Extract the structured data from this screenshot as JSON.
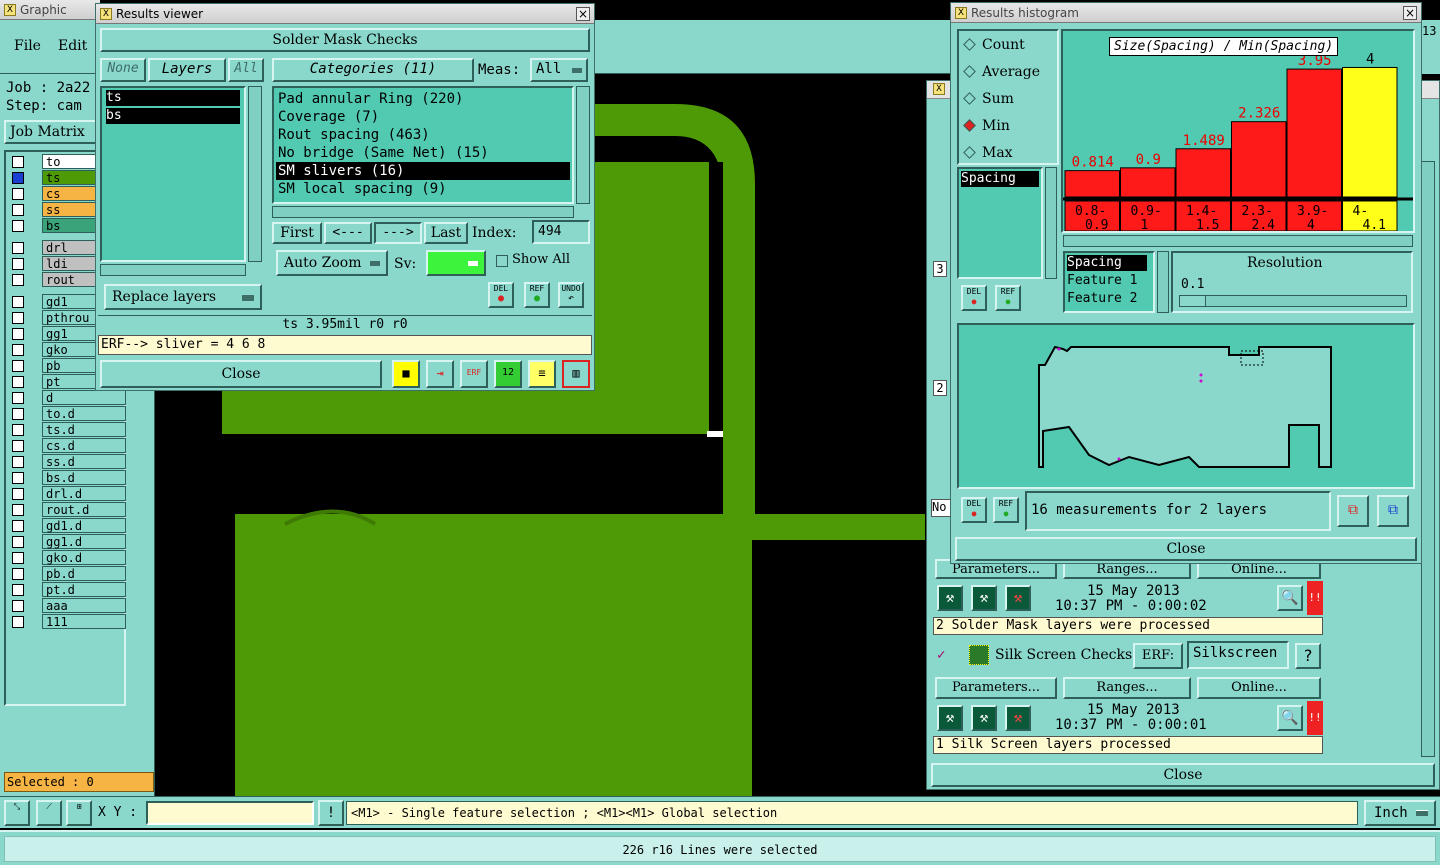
{
  "main_window": {
    "title": "Graphic Editor",
    "menu": [
      "File",
      "Edit"
    ],
    "job_label": "Job : 2a22",
    "step_label": "Step: cam",
    "job_matrix": "Job Matrix",
    "layers": [
      {
        "name": "to",
        "color": "#ffffff"
      },
      {
        "name": "ts",
        "color": "#4e9a06"
      },
      {
        "name": "cs",
        "color": "#f6b445"
      },
      {
        "name": "ss",
        "color": "#f6b445"
      },
      {
        "name": "bs",
        "color": "#3aa37a"
      },
      {
        "name": "drl",
        "color": "#c0c0c0"
      },
      {
        "name": "ldi",
        "color": "#c0c0c0"
      },
      {
        "name": "rout",
        "color": "#c0c0c0"
      },
      {
        "name": "gd1",
        "color": "#8ad8cc"
      },
      {
        "name": "pthrou",
        "color": "#8ad8cc"
      },
      {
        "name": "gg1",
        "color": "#8ad8cc"
      },
      {
        "name": "gko",
        "color": "#8ad8cc"
      },
      {
        "name": "pb",
        "color": "#8ad8cc"
      },
      {
        "name": "pt",
        "color": "#8ad8cc"
      },
      {
        "name": "d",
        "color": "#8ad8cc"
      },
      {
        "name": "to.d",
        "color": "#8ad8cc"
      },
      {
        "name": "ts.d",
        "color": "#8ad8cc"
      },
      {
        "name": "cs.d",
        "color": "#8ad8cc"
      },
      {
        "name": "ss.d",
        "color": "#8ad8cc"
      },
      {
        "name": "bs.d",
        "color": "#8ad8cc"
      },
      {
        "name": "drl.d",
        "color": "#8ad8cc"
      },
      {
        "name": "rout.d",
        "color": "#8ad8cc"
      },
      {
        "name": "gd1.d",
        "color": "#8ad8cc"
      },
      {
        "name": "gg1.d",
        "color": "#8ad8cc"
      },
      {
        "name": "gko.d",
        "color": "#8ad8cc"
      },
      {
        "name": "pb.d",
        "color": "#8ad8cc"
      },
      {
        "name": "pt.d",
        "color": "#8ad8cc"
      },
      {
        "name": "aaa",
        "color": "#8ad8cc"
      },
      {
        "name": "111",
        "color": "#8ad8cc"
      }
    ],
    "selected": "Selected : 0",
    "xy_label": "X Y :",
    "hint": "<M1> - Single feature selection ; <M1><M1> Global selection",
    "units": "Inch",
    "status": "226 r16 Lines were selected",
    "corner_text": "13"
  },
  "results_viewer": {
    "title": "Results viewer",
    "heading": "Solder Mask Checks",
    "none_btn": "None",
    "layers_btn": "Layers",
    "all_btn": "All",
    "layers": [
      "ts",
      "bs"
    ],
    "categories_btn": "Categories (11)",
    "meas_label": "Meas:",
    "meas_value": "All",
    "categories": [
      "Pad annular Ring (220)",
      "Coverage (7)",
      "Rout spacing (463)",
      "No bridge (Same Net) (15)",
      "SM slivers (16)",
      "SM local spacing (9)"
    ],
    "first": "First",
    "prev": "<---",
    "next": "--->",
    "last": "Last",
    "index_label": "Index:",
    "index_value": "494",
    "auto_zoom": "Auto Zoom",
    "sv_label": "Sv:",
    "show_all": "Show All",
    "replace_layers": "Replace layers",
    "del": "DEL",
    "ref": "REF",
    "undo": "UNDO",
    "info": "ts 3.95mil  r0  r0",
    "erf": "ERF--> sliver = 4 6 8",
    "close": "Close"
  },
  "histogram": {
    "title": "Results histogram",
    "modes": [
      "Count",
      "Average",
      "Sum",
      "Min",
      "Max"
    ],
    "selected_mode": "Min",
    "chart_title": "Size(Spacing) / Min(Spacing)",
    "list_item": "Spacing",
    "params": [
      "Spacing",
      "Feature 1",
      "Feature 2"
    ],
    "resolution_label": "Resolution",
    "resolution_value": "0.1",
    "measure_text": "16 measurements for 2 layers",
    "close": "Close",
    "del": "DEL",
    "ref": "REF"
  },
  "chart_data": {
    "type": "bar",
    "title": "Size(Spacing) / Min(Spacing)",
    "categories": [
      "0.8-0.9",
      "0.9-1",
      "1.4-1.5",
      "2.3-2.4",
      "3.9-4",
      "4-4.1"
    ],
    "values": [
      0.814,
      0.9,
      1.489,
      2.326,
      3.95,
      4
    ],
    "value_labels": [
      "0.814",
      "0.9",
      "1.489",
      "2.326",
      "3.95",
      "4"
    ],
    "cat_line1": [
      "0.8-",
      "0.9-",
      "1.4-",
      "2.3-",
      "3.9-",
      "4-"
    ],
    "cat_line2": [
      "0.9",
      "1",
      "1.5",
      "2.4",
      "4",
      "4.1"
    ],
    "ylim": [
      0,
      4.2
    ],
    "colors": [
      "#ff1a1a",
      "#ff1a1a",
      "#ff1a1a",
      "#ff1a1a",
      "#ff1a1a",
      "#ffff1a"
    ],
    "grid": false
  },
  "checklist": {
    "rows": [
      {
        "date": "15 May 2013",
        "time": "10:37 PM - 0:00:02",
        "msg": "2 Solder Mask layers were processed"
      },
      {
        "date": "15 May 2013",
        "time": "10:37 PM - 0:00:01",
        "msg": "1 Silk Screen layers processed"
      }
    ],
    "silk_label": "Silk Screen Checks",
    "erf_label": "ERF:",
    "erf_value": "Silkscreen",
    "parameters": "Parameters...",
    "ranges": "Ranges...",
    "online": "Online...",
    "side_nums": [
      "3",
      "2"
    ],
    "side_text": "No",
    "close": "Close",
    "help": "?"
  }
}
